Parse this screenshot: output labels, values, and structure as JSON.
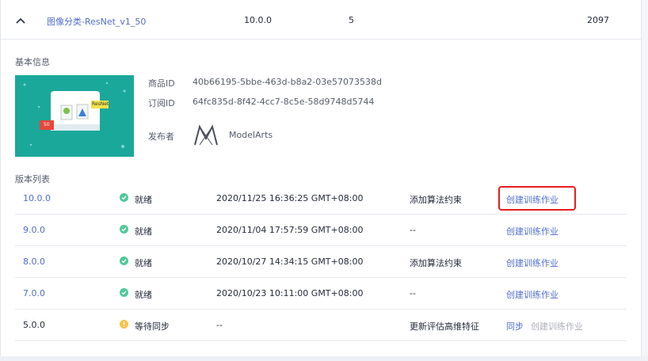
{
  "summary": {
    "name": "图像分类-ResNet_v1_50",
    "version": "10.0.0",
    "count": "5",
    "number": "2097"
  },
  "basic_info": {
    "title": "基本信息",
    "product_id_label": "商品ID",
    "product_id": "40b66195-5bbe-463d-b8a2-03e57073538d",
    "subscription_id_label": "订阅ID",
    "subscription_id": "64fc835d-8f42-4cc7-8c5e-58d9748d5744",
    "publisher_label": "发布者",
    "publisher": "ModelArts",
    "thumbnail_badges": [
      "ResNet",
      "50"
    ]
  },
  "versions": {
    "title": "版本列表",
    "rows": [
      {
        "version": "10.0.0",
        "status": "就绪",
        "status_color": "#50c99b",
        "time": "2020/11/25 16:36:25 GMT+08:00",
        "constraint": "添加算法约束",
        "action": "创建训练作业",
        "action2": ""
      },
      {
        "version": "9.0.0",
        "status": "就绪",
        "status_color": "#50c99b",
        "time": "2020/11/04 17:57:59 GMT+08:00",
        "constraint": "--",
        "action": "创建训练作业",
        "action2": ""
      },
      {
        "version": "8.0.0",
        "status": "就绪",
        "status_color": "#50c99b",
        "time": "2020/10/27 14:34:15 GMT+08:00",
        "constraint": "添加算法约束",
        "action": "创建训练作业",
        "action2": ""
      },
      {
        "version": "7.0.0",
        "status": "就绪",
        "status_color": "#50c99b",
        "time": "2020/10/23 10:11:00 GMT+08:00",
        "constraint": "--",
        "action": "创建训练作业",
        "action2": ""
      },
      {
        "version": "5.0.0",
        "status": "等待同步",
        "status_color": "#f7c34a",
        "time": "--",
        "constraint": "更新评估高维特征",
        "action": "同步",
        "action2": "创建训练作业"
      }
    ]
  },
  "colors": {
    "link": "#526ecc",
    "disabled": "#adb0b8",
    "highlight": "#e61e1e",
    "thumbnail_bg": "#1aa89a"
  }
}
